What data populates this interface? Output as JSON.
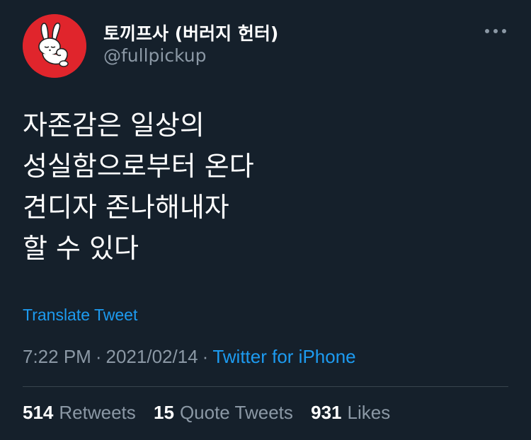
{
  "author": {
    "display_name": "토끼프사 (버러지 헌터)",
    "handle": "@fullpickup",
    "avatar_icon": "rabbit-avatar-icon",
    "avatar_bg": "#e0252c"
  },
  "menu_icon": "more-dots-icon",
  "tweet": {
    "lines": [
      "자존감은 일상의",
      "성실함으로부터 온다",
      "견디자 존나해내자",
      "할 수 있다"
    ],
    "translate_label": "Translate Tweet"
  },
  "meta": {
    "time": "7:22 PM",
    "separator": "·",
    "date": "2021/02/14",
    "source": "Twitter for iPhone"
  },
  "stats": {
    "retweets": {
      "count": "514",
      "label": "Retweets"
    },
    "quotes": {
      "count": "15",
      "label": "Quote Tweets"
    },
    "likes": {
      "count": "931",
      "label": "Likes"
    }
  },
  "colors": {
    "background": "#15202b",
    "link": "#1d9bf0",
    "muted": "#8b98a5",
    "divider": "#38444d"
  }
}
